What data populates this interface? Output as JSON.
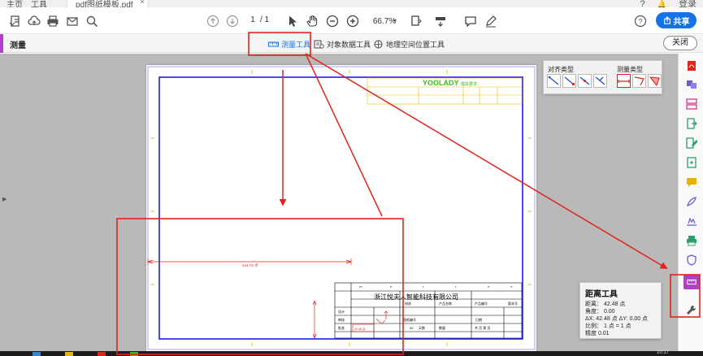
{
  "tabs": {
    "home": "主页",
    "tools": "工具",
    "document": "pdf图纸模板.pdf",
    "close_glyph": "×"
  },
  "account": {
    "help_glyph": "?",
    "bell_glyph": "🔔",
    "login_label": "登录"
  },
  "toolbar": {
    "page_current": "1",
    "page_total": "/ 1",
    "zoom": "66.7%",
    "share_label": "共享"
  },
  "measure_bar": {
    "title": "测量",
    "tools": [
      {
        "label": "测量工具",
        "icon": "ruler-icon",
        "active": true
      },
      {
        "label": "对象数据工具",
        "icon": "object-data-icon",
        "active": false
      },
      {
        "label": "地理空间位置工具",
        "icon": "geo-location-icon",
        "active": false
      }
    ],
    "close_label": "关闭"
  },
  "type_panel": {
    "snap_label": "对齐类型",
    "measure_label": "测量类型"
  },
  "drawing": {
    "brand": "YOOLADY",
    "brand_sub": "模具要求",
    "company": "浙江悦夫人智能科技有限公司",
    "dimension": "441.73 点",
    "cell_design": "设计",
    "cell_review": "审核",
    "cell_approve": "批准",
    "cell_value": "42.48 点",
    "cell_material": "材质",
    "cell_product_name": "产品名称",
    "cell_product_no": "产品编号",
    "cell_drawing_no": "图纸编号",
    "cell_version": "版本号",
    "cell_qty": "30",
    "cell_unit": "天数",
    "cell_date": "日期",
    "cell_count": "数量",
    "cell_sheet": "共   页   第   页"
  },
  "distance_panel": {
    "title": "距离工具",
    "distance": "距离：  42.48 点",
    "angle": "角度：   0.00",
    "delta": "ΔX:   42.48 点   ΔY:   0.00 点",
    "scale": "比例：   1 点 = 1 点",
    "precision": "精度     0.01"
  },
  "taskbar": {
    "clock": "10:17"
  },
  "colors": {
    "accent_blue": "#1473e6",
    "measure_purple": "#b13ec6",
    "annotation_red": "#e2231a",
    "drawing_blue": "#1a1aff",
    "drawing_green": "#36c20b"
  }
}
